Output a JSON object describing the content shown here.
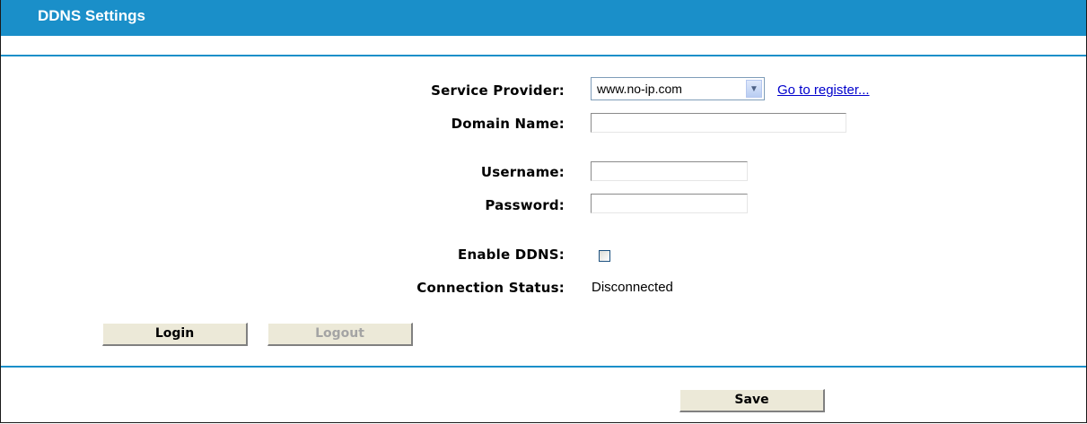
{
  "header": {
    "title": "DDNS Settings"
  },
  "form": {
    "service_provider": {
      "label": "Service Provider:",
      "selected": "www.no-ip.com",
      "register_link": "Go to register..."
    },
    "domain_name": {
      "label": "Domain Name:",
      "value": ""
    },
    "username": {
      "label": "Username:",
      "value": ""
    },
    "password": {
      "label": "Password:",
      "value": ""
    },
    "enable_ddns": {
      "label": "Enable DDNS:",
      "checked": false
    },
    "connection_status": {
      "label": "Connection Status:",
      "value": "Disconnected"
    }
  },
  "buttons": {
    "login": "Login",
    "logout": "Logout",
    "save": "Save"
  },
  "colors": {
    "accent": "#1a8fc9",
    "link": "#0000cc",
    "button_face": "#ece9d8"
  }
}
